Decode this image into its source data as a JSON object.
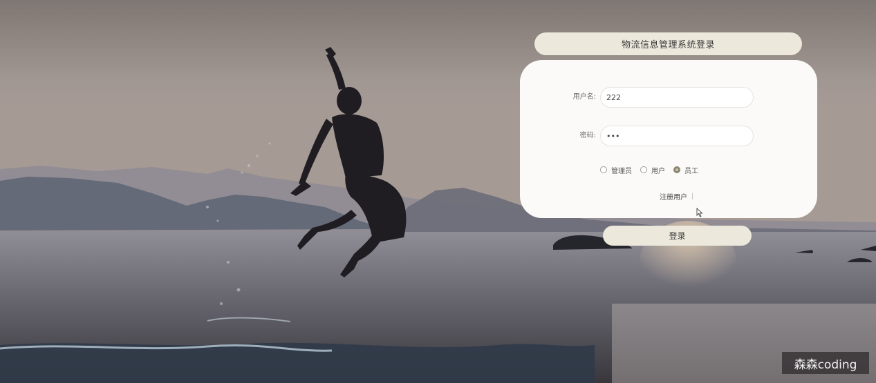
{
  "login": {
    "title": "物流信息管理系统登录",
    "username_label": "用户名:",
    "username_value": "222",
    "password_label": "密码:",
    "password_value": "•••",
    "roles": [
      {
        "label": "管理员",
        "checked": false
      },
      {
        "label": "用户",
        "checked": false
      },
      {
        "label": "员工",
        "checked": true
      }
    ],
    "register_link": "注册用户",
    "separator": "|",
    "submit_label": "登录"
  },
  "watermark": {
    "text": "森森coding"
  },
  "colors": {
    "panel": "#ece8dc",
    "card": "#fbfaf8",
    "radio_checked": "#8c8670"
  },
  "icons": {
    "cursor": "mouse-pointer-icon"
  }
}
